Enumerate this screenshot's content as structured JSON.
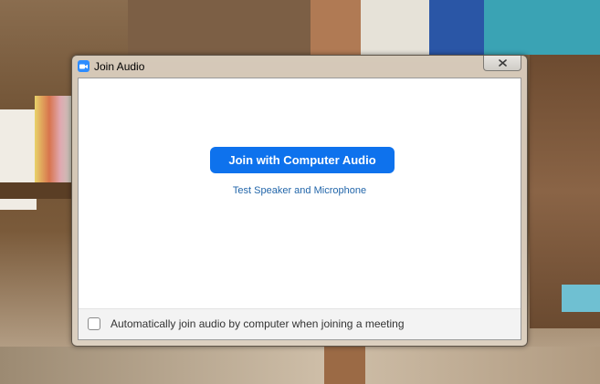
{
  "window": {
    "title": "Join Audio",
    "app_icon": "video-camera-icon",
    "close_icon": "close-icon"
  },
  "main": {
    "join_button_label": "Join with Computer Audio",
    "test_link_label": "Test Speaker and Microphone"
  },
  "footer": {
    "auto_join_label": "Automatically join audio by computer when joining a meeting",
    "auto_join_checked": false
  },
  "colors": {
    "accent": "#0e72ed",
    "link": "#2266aa",
    "app_icon": "#2d8cff"
  }
}
